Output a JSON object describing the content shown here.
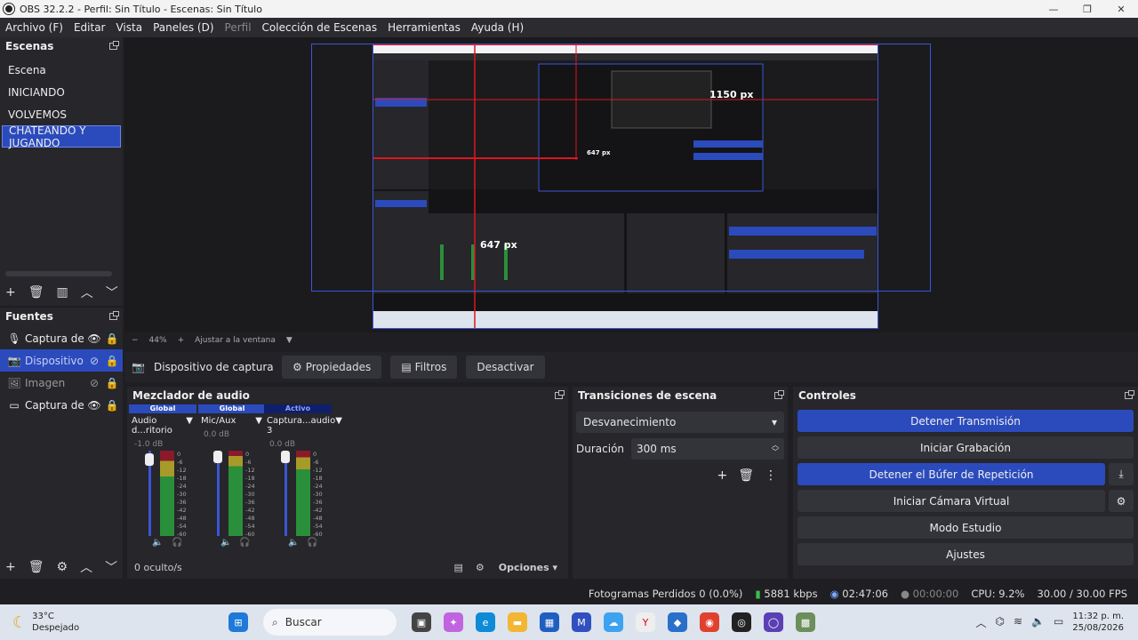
{
  "window": {
    "title": "OBS 32.2.2 - Perfil: Sin Título - Escenas: Sin Título"
  },
  "menu": [
    "Archivo (F)",
    "Editar",
    "Vista",
    "Paneles (D)",
    "Perfil",
    "Colección de Escenas",
    "Herramientas",
    "Ayuda (H)"
  ],
  "scenes": {
    "header": "Escenas",
    "items": [
      "Escena",
      "INICIANDO",
      "VOLVEMOS",
      "CHATEANDO Y JUGANDO"
    ],
    "selected": 3
  },
  "sources": {
    "header": "Fuentes",
    "items": [
      {
        "name": "Captura de e",
        "icon": "mic-icon"
      },
      {
        "name": "Dispositivo c",
        "icon": "camera-icon"
      },
      {
        "name": "Imagen",
        "icon": "image-icon"
      },
      {
        "name": "Captura de p",
        "icon": "monitor-icon"
      }
    ]
  },
  "preview": {
    "nested_labels": [
      "1150 px",
      "647 px",
      "647 px"
    ],
    "zoom": "44%",
    "fit_label": "Ajustar a la ventana"
  },
  "toolbar": {
    "source_label": "Dispositivo de captura de v",
    "properties": "Propiedades",
    "filters": "Filtros",
    "deactivate": "Desactivar"
  },
  "mixer": {
    "header": "Mezclador de audio",
    "channels": [
      {
        "tag": "Global",
        "name": "Audio d...ritorio",
        "db": "-1.0 dB"
      },
      {
        "tag": "Global",
        "name": "Mic/Aux",
        "db": "0.0 dB"
      },
      {
        "tag": "Activo",
        "name": "Captura...audio 3",
        "db": "0.0 dB"
      }
    ],
    "ticks": [
      "0",
      "-6",
      "-12",
      "-18",
      "-24",
      "-30",
      "-36",
      "-42",
      "-48",
      "-54",
      "-60"
    ],
    "hidden": "0 oculto/s",
    "options": "Opciones"
  },
  "transitions": {
    "header": "Transiciones de escena",
    "selected": "Desvanecimiento",
    "duration_label": "Duración",
    "duration_value": "300 ms"
  },
  "controls": {
    "header": "Controles",
    "stop_stream": "Detener Transmisión",
    "start_recording": "Iniciar Grabación",
    "stop_replay": "Detener el Búfer de Repetición",
    "virtual_cam": "Iniciar Cámara Virtual",
    "studio_mode": "Modo Estudio",
    "settings": "Ajustes"
  },
  "status": {
    "dropped": "Fotogramas Perdidos 0 (0.0%)",
    "kbps": "5881 kbps",
    "stream_time": "02:47:06",
    "rec_time": "00:00:00",
    "cpu": "CPU: 9.2%",
    "fps": "30.00 / 30.00 FPS"
  },
  "taskbar": {
    "temp": "33°C",
    "weather": "Despejado",
    "search": "Buscar",
    "time": "11:32 p. m.",
    "date": "25/08/2026"
  },
  "colors": {
    "accent": "#2b4bbd",
    "selection_border": "#3b55d6",
    "guide_red": "#e0141e"
  }
}
